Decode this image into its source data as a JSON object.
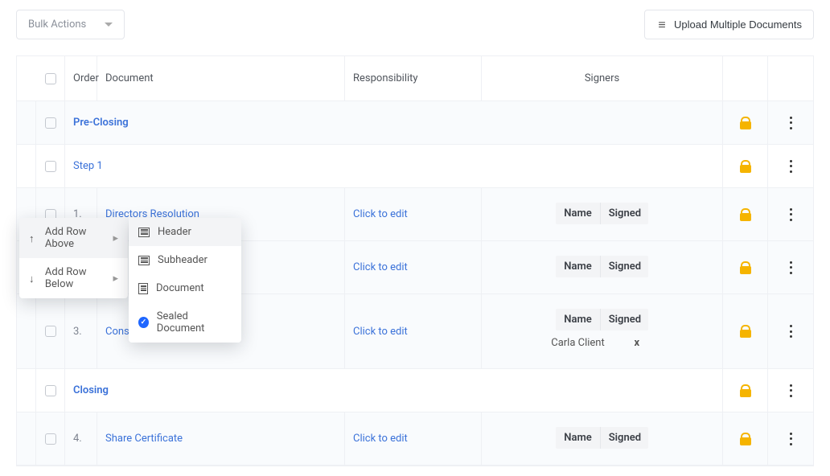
{
  "topbar": {
    "bulk_label": "Bulk Actions",
    "upload_label": "Upload Multiple Documents"
  },
  "columns": {
    "order": "Order",
    "document": "Document",
    "responsibility": "Responsibility",
    "signers": "Signers",
    "name": "Name",
    "signed": "Signed"
  },
  "click_edit": "Click to edit",
  "sections": {
    "pre_closing": "Pre-Closing",
    "step1": "Step 1",
    "closing": "Closing"
  },
  "rows": [
    {
      "order": "1.",
      "doc": "Directors Resolution"
    },
    {
      "order": "",
      "doc": ""
    },
    {
      "order": "3.",
      "doc": "Consent"
    },
    {
      "order": "4.",
      "doc": "Share Certificate"
    }
  ],
  "signers": {
    "carla": {
      "name": "Carla Client",
      "signed": "x"
    }
  },
  "ctx1": {
    "above": "Add Row Above",
    "below": "Add Row Below"
  },
  "ctx2": {
    "header": "Header",
    "subheader": "Subheader",
    "document": "Document",
    "sealed": "Sealed Document"
  }
}
